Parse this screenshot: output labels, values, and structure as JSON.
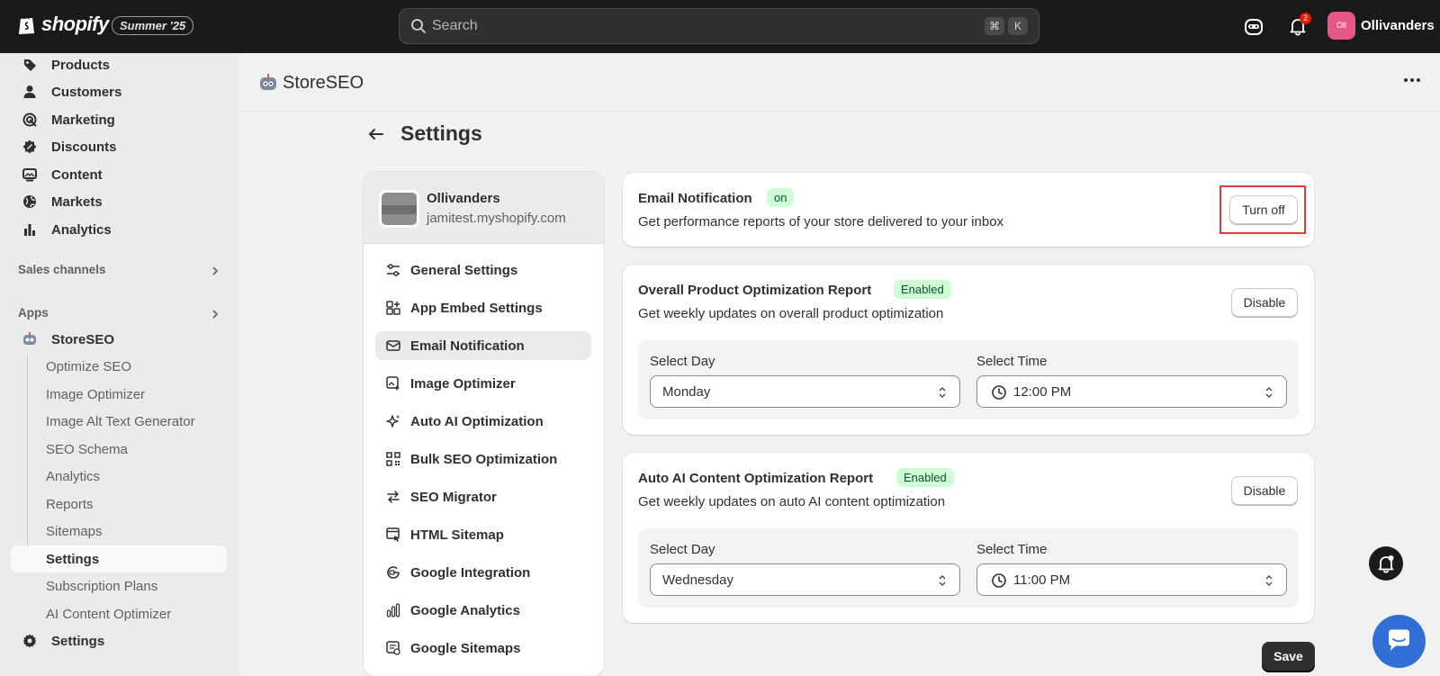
{
  "topbar": {
    "brand": "shopify",
    "edition": "Summer '25",
    "search_placeholder": "Search",
    "shortcut_cmd": "⌘",
    "shortcut_key": "K",
    "notification_count": "2",
    "store_initials": "Oll",
    "store_name": "Ollivanders"
  },
  "sidebar": {
    "items": [
      {
        "label": "Products",
        "icon": "tag-icon"
      },
      {
        "label": "Customers",
        "icon": "person-icon"
      },
      {
        "label": "Marketing",
        "icon": "target-icon"
      },
      {
        "label": "Discounts",
        "icon": "discount-icon"
      },
      {
        "label": "Content",
        "icon": "image-icon"
      },
      {
        "label": "Markets",
        "icon": "globe-icon"
      },
      {
        "label": "Analytics",
        "icon": "bar-chart-icon"
      }
    ],
    "sales_channels": "Sales channels",
    "apps": "Apps",
    "app_name": "StoreSEO",
    "app_subitems": [
      "Optimize SEO",
      "Image Optimizer",
      "Image Alt Text Generator",
      "SEO Schema",
      "Analytics",
      "Reports",
      "Sitemaps",
      "Settings",
      "Subscription Plans",
      "AI Content Optimizer"
    ],
    "settings": "Settings"
  },
  "app_header": {
    "title": "StoreSEO"
  },
  "page": {
    "title": "Settings"
  },
  "settings_nav": {
    "store_name": "Ollivanders",
    "store_domain": "jamitest.myshopify.com",
    "items": [
      {
        "label": "General Settings",
        "icon": "sliders-icon"
      },
      {
        "label": "App Embed Settings",
        "icon": "app-embed-icon"
      },
      {
        "label": "Email Notification",
        "icon": "email-icon"
      },
      {
        "label": "Image Optimizer",
        "icon": "image-magic-icon"
      },
      {
        "label": "Auto AI Optimization",
        "icon": "sparkle-icon"
      },
      {
        "label": "Bulk SEO Optimization",
        "icon": "qr-grid-icon"
      },
      {
        "label": "SEO Migrator",
        "icon": "arrows-swap-icon"
      },
      {
        "label": "HTML Sitemap",
        "icon": "sitemap-icon"
      },
      {
        "label": "Google Integration",
        "icon": "google-icon"
      },
      {
        "label": "Google Analytics",
        "icon": "analytics-bars-icon"
      },
      {
        "label": "Google Sitemaps",
        "icon": "google-sitemap-icon"
      }
    ],
    "active_index": 2
  },
  "email_card": {
    "title": "Email Notification",
    "badge": "on",
    "description": "Get performance reports of your store delivered to your inbox",
    "button": "Turn off"
  },
  "product_report": {
    "title": "Overall Product Optimization Report",
    "badge": "Enabled",
    "description": "Get weekly updates on overall product optimization",
    "button": "Disable",
    "day_label": "Select Day",
    "day_value": "Monday",
    "time_label": "Select Time",
    "time_value": "12:00 PM"
  },
  "ai_report": {
    "title": "Auto AI Content Optimization Report",
    "badge": "Enabled",
    "description": "Get weekly updates on auto AI content optimization",
    "button": "Disable",
    "day_label": "Select Day",
    "day_value": "Wednesday",
    "time_label": "Select Time",
    "time_value": "11:00 PM"
  },
  "save_label": "Save",
  "colors": {
    "topbar": "#1a1a1a",
    "badge_bg": "#cdfed4",
    "highlight": "#e0403a",
    "chat": "#2f6fd6"
  }
}
